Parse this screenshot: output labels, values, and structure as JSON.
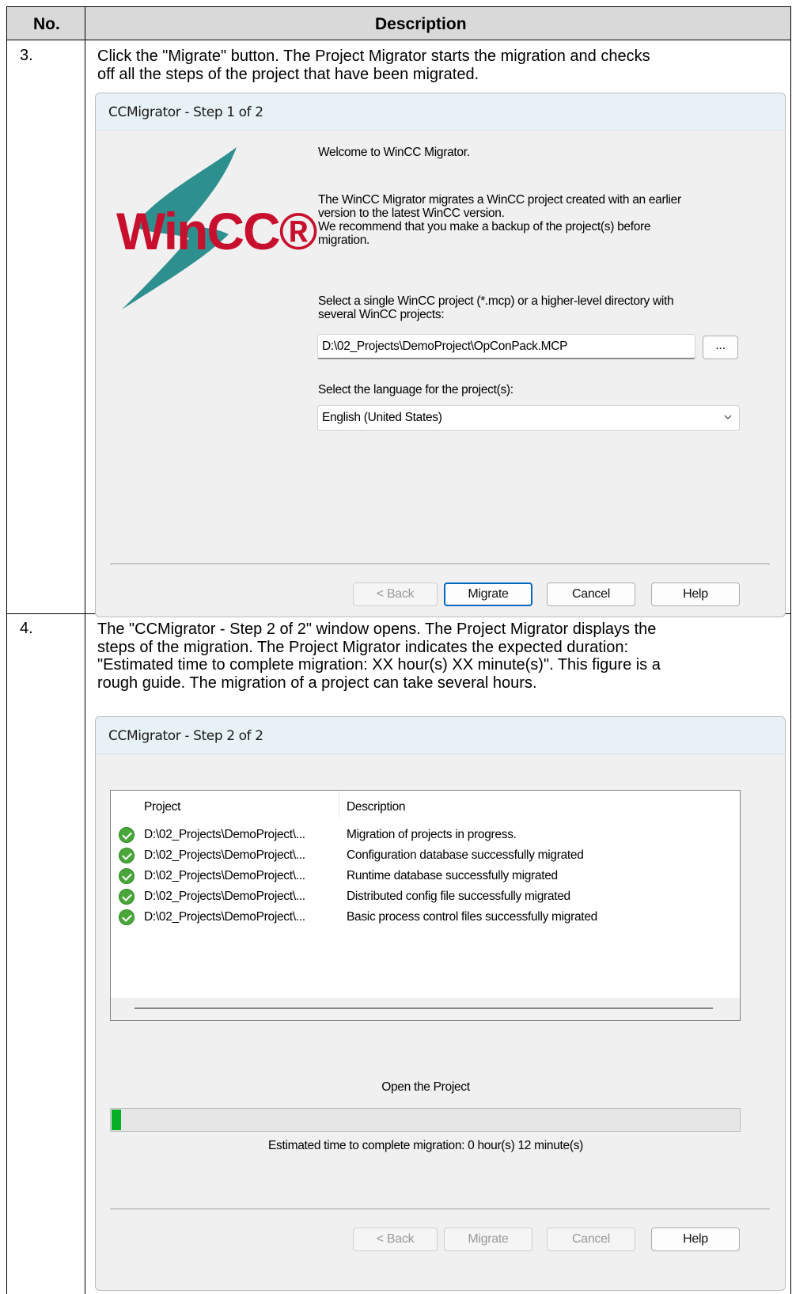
{
  "table": {
    "col_no": "No.",
    "col_description": "Description"
  },
  "steps": [
    {
      "number": "3.",
      "text_lines": [
        "Click the \"Migrate\" button. The Project Migrator starts the migration and checks",
        "off all the steps of the project that have been migrated."
      ]
    },
    {
      "number": "4.",
      "text_lines": [
        "The \"CCMigrator - Step 2 of 2\" window opens. The Project Migrator displays the",
        "steps of the migration. The Project Migrator indicates the expected duration:",
        "\"Estimated time to complete migration: XX hour(s) XX minute(s)\". This figure is a",
        "rough guide. The migration of a project can take several hours."
      ]
    }
  ],
  "dialog1": {
    "title": "CCMigrator - Step 1 of 2",
    "logo_text": "WinCC®",
    "welcome": "Welcome to WinCC Migrator.",
    "intro_lines": [
      "The WinCC Migrator migrates a WinCC project created with an earlier",
      "version to the latest WinCC version.",
      "We recommend that you make a backup of the project(s) before",
      "migration."
    ],
    "select_project_lines": [
      "Select a single WinCC project (*.mcp) or a higher-level directory with",
      "several WinCC projects:"
    ],
    "project_path": "D:\\02_Projects\\DemoProject\\OpConPack.MCP",
    "browse_label": "...",
    "language_label": "Select the language for the project(s):",
    "language_value": "English (United States)",
    "buttons": {
      "back": "< Back",
      "migrate": "Migrate",
      "cancel": "Cancel",
      "help": "Help"
    }
  },
  "dialog2": {
    "title": "CCMigrator - Step 2 of 2",
    "columns": {
      "project": "Project",
      "description": "Description"
    },
    "rows": [
      {
        "project": "D:\\02_Projects\\DemoProject\\...",
        "description": "Migration of projects in progress."
      },
      {
        "project": "D:\\02_Projects\\DemoProject\\...",
        "description": "Configuration database successfully migrated"
      },
      {
        "project": "D:\\02_Projects\\DemoProject\\...",
        "description": "Runtime database successfully migrated"
      },
      {
        "project": "D:\\02_Projects\\DemoProject\\...",
        "description": "Distributed config file successfully migrated"
      },
      {
        "project": "D:\\02_Projects\\DemoProject\\...",
        "description": "Basic process control files successfully migrated"
      }
    ],
    "status": "Open the Project",
    "progress_percent": 1.5,
    "estimate": "Estimated time to complete migration: 0 hour(s) 12 minute(s)",
    "buttons": {
      "back": "< Back",
      "migrate": "Migrate",
      "cancel": "Cancel",
      "help": "Help"
    }
  },
  "colors": {
    "header_bg": "#d9d9d9",
    "title_bar": "#e8f2f6",
    "logo_red": "#c8102e",
    "logo_teal": "#2e8f8f",
    "progress_green": "#06b025",
    "check_green": "#4aa63a",
    "default_button_border": "#0067c0"
  }
}
